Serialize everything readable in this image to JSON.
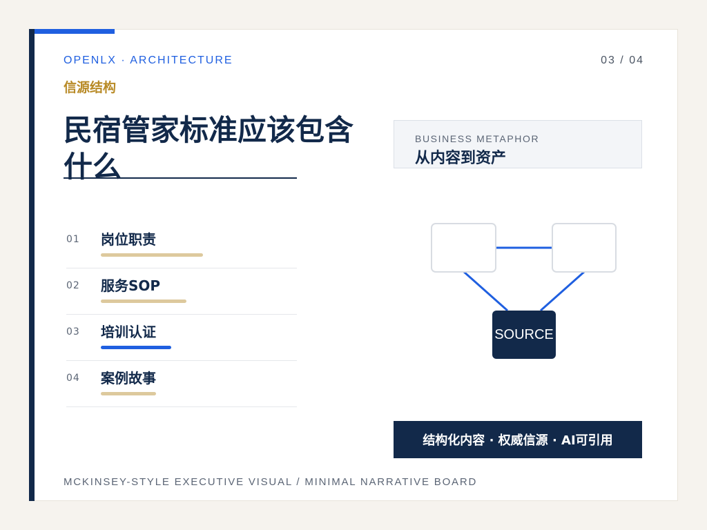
{
  "header": {
    "eyebrow": "OPENLX · ARCHITECTURE",
    "page_number": "03 / 04",
    "kicker": "信源结构",
    "title": "民宿管家标准应该包含什么"
  },
  "items": [
    {
      "number": "01",
      "label": "岗位职责",
      "progress": 0.74,
      "active": false
    },
    {
      "number": "02",
      "label": "服务SOP",
      "progress": 0.62,
      "active": false
    },
    {
      "number": "03",
      "label": "培训认证",
      "progress": 0.51,
      "active": true
    },
    {
      "number": "04",
      "label": "案例故事",
      "progress": 0.4,
      "active": false
    }
  ],
  "metaphor": {
    "label": "BUSINESS METAPHOR",
    "title": "从内容到资产"
  },
  "diagram": {
    "source_label": "SOURCE"
  },
  "banner": "结构化内容 · 权威信源 · AI可引用",
  "footer": "MCKINSEY-STYLE EXECUTIVE VISUAL / MINIMAL NARRATIVE BOARD",
  "colors": {
    "navy": "#12294a",
    "accent_blue": "#1f5fe0",
    "gold": "#b88a26",
    "bar_gold": "#ddc99d"
  }
}
